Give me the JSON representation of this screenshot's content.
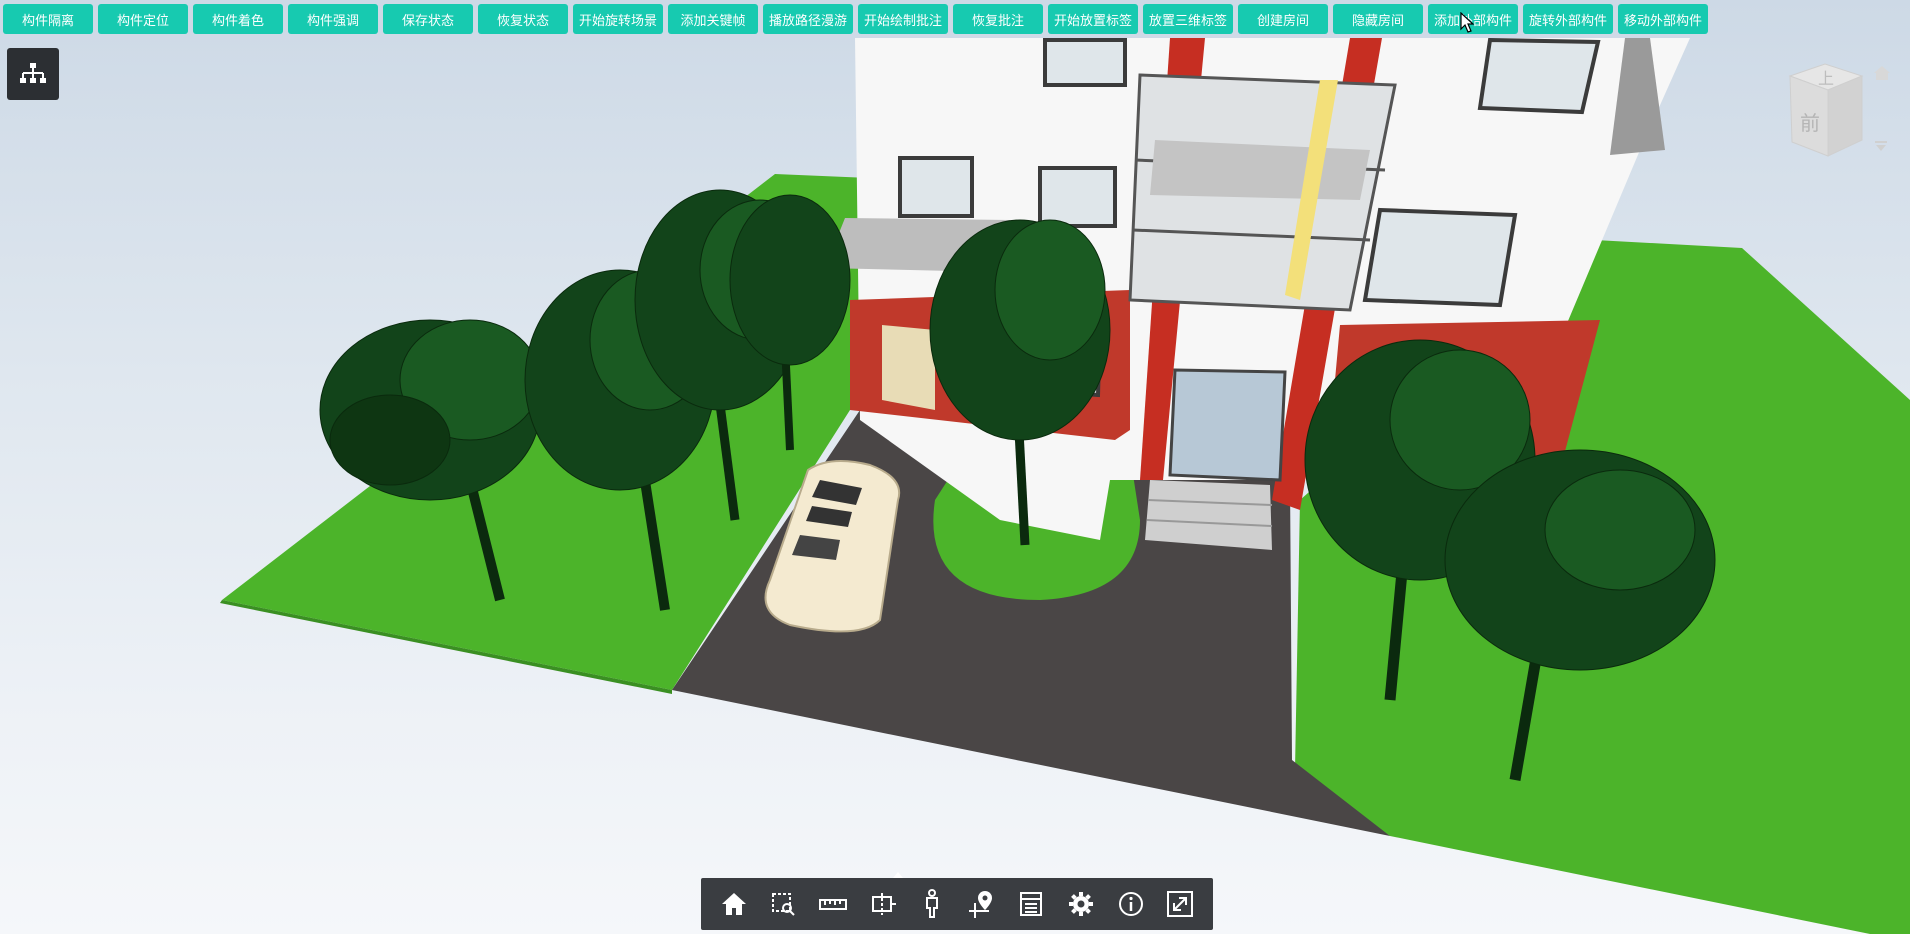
{
  "toolbar": {
    "buttons": [
      {
        "label": "构件隔离"
      },
      {
        "label": "构件定位"
      },
      {
        "label": "构件着色"
      },
      {
        "label": "构件强调"
      },
      {
        "label": "保存状态"
      },
      {
        "label": "恢复状态"
      },
      {
        "label": "开始旋转场景"
      },
      {
        "label": "添加关键帧"
      },
      {
        "label": "播放路径漫游"
      },
      {
        "label": "开始绘制批注"
      },
      {
        "label": "恢复批注"
      },
      {
        "label": "开始放置标签"
      },
      {
        "label": "放置三维标签"
      },
      {
        "label": "创建房间"
      },
      {
        "label": "隐藏房间"
      },
      {
        "label": "添加外部构件"
      },
      {
        "label": "旋转外部构件"
      },
      {
        "label": "移动外部构件"
      }
    ],
    "button_color": "#17cab0"
  },
  "viewcube": {
    "top_label": "上",
    "front_label": "前"
  },
  "bottom_toolbar": {
    "icons": [
      "home-icon",
      "zoom-box-icon",
      "ruler-icon",
      "section-box-icon",
      "walk-person-icon",
      "map-pin-icon",
      "properties-list-icon",
      "settings-gear-icon",
      "info-icon",
      "fullscreen-icon"
    ]
  },
  "scene": {
    "ground_color": "#4cb42a",
    "road_color": "#4a4646",
    "wall_color": "#c0392b"
  }
}
